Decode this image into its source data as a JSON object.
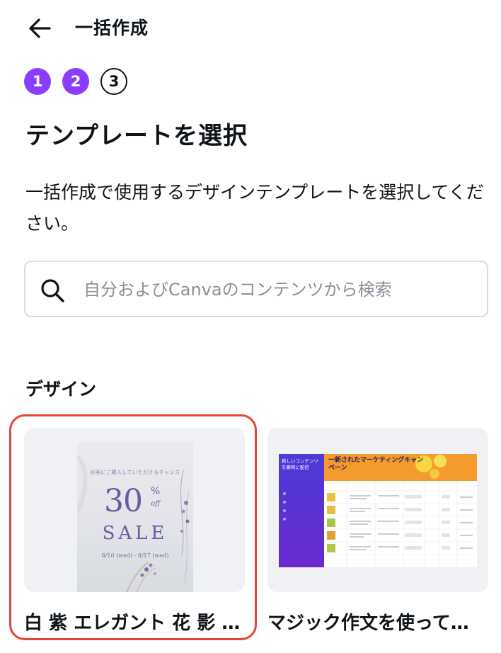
{
  "header": {
    "title": "一括作成"
  },
  "steps": [
    {
      "label": "1",
      "state": "done"
    },
    {
      "label": "2",
      "state": "done"
    },
    {
      "label": "3",
      "state": "current"
    }
  ],
  "page": {
    "title": "テンプレートを選択",
    "description": "一括作成で使用するデザインテンプレートを選択してください。"
  },
  "search": {
    "placeholder": "自分およびCanvaのコンテンツから検索",
    "value": ""
  },
  "section": {
    "title": "デザイン"
  },
  "designs": [
    {
      "title": "白 紫 エレガント 花 影 …",
      "selected": true,
      "thumb": {
        "subtitle": "お客にご購入していただけるチャンス",
        "percent": "30",
        "pct_sign": "%",
        "off": "off",
        "sale": "SALE",
        "dates": "8/10 (wed) - 8/17 (wed)"
      }
    },
    {
      "title": "マジック作文を使って…",
      "selected": false,
      "thumb": {
        "left_title": "新しいコンテンツを瞬時に配信",
        "banner_title": "一新されたマーケティングキャンペーン"
      }
    }
  ],
  "colors": {
    "accent": "#8b3dff",
    "selection": "#e64535",
    "text": "#0e1318",
    "muted": "#8a9099"
  }
}
